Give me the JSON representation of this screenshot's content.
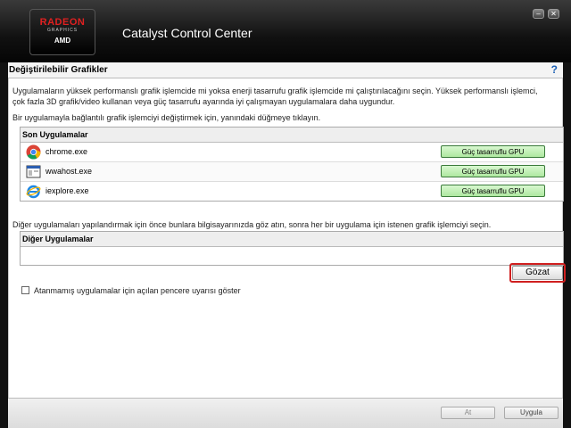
{
  "window": {
    "logo": {
      "brand": "RADEON",
      "sub": "GRAPHICS",
      "maker": "AMD"
    },
    "title": "Catalyst Control Center",
    "minimize_glyph": "–",
    "close_glyph": "✕"
  },
  "header": {
    "title": "Değiştirilebilir Grafikler",
    "help_glyph": "?"
  },
  "intro": {
    "para1": "Uygulamaların yüksek performanslı grafik işlemcide mi yoksa enerji tasarrufu grafik işlemcide mi çalıştırılacağını seçin. Yüksek performanslı işlemci, çok fazla 3D grafik/video kullanan veya güç tasarrufu ayarında iyi çalışmayan uygulamalara daha uygundur.",
    "para2": "Bir uygulamayla bağlantılı grafik işlemciyi değiştirmek için, yanındaki düğmeye tıklayın."
  },
  "recent": {
    "header": "Son Uygulamalar",
    "apps": [
      {
        "name": "chrome.exe",
        "icon": "chrome-icon",
        "gpu": "Güç tasarruflu GPU"
      },
      {
        "name": "wwahost.exe",
        "icon": "window-app-icon",
        "gpu": "Güç tasarruflu GPU"
      },
      {
        "name": "iexplore.exe",
        "icon": "internet-explorer-icon",
        "gpu": "Güç tasarruflu GPU"
      }
    ]
  },
  "other": {
    "description": "Diğer uygulamaları yapılandırmak için önce bunlara bilgisayarınızda göz atın, sonra her bir uygulama için istenen grafik işlemciyi seçin.",
    "header": "Diğer Uygulamalar",
    "browse_label": "Gözat"
  },
  "warning_checkbox": {
    "label": "Atanmamış uygulamalar için açılan pencere uyarısı göster",
    "checked": false
  },
  "footer": {
    "apply_label": "At",
    "ok_label": "Uygula"
  },
  "colors": {
    "gpu_button": "#aee8a0",
    "highlight_ring": "#d02020",
    "title_bar": "#111111",
    "accent_red": "#e02020"
  }
}
